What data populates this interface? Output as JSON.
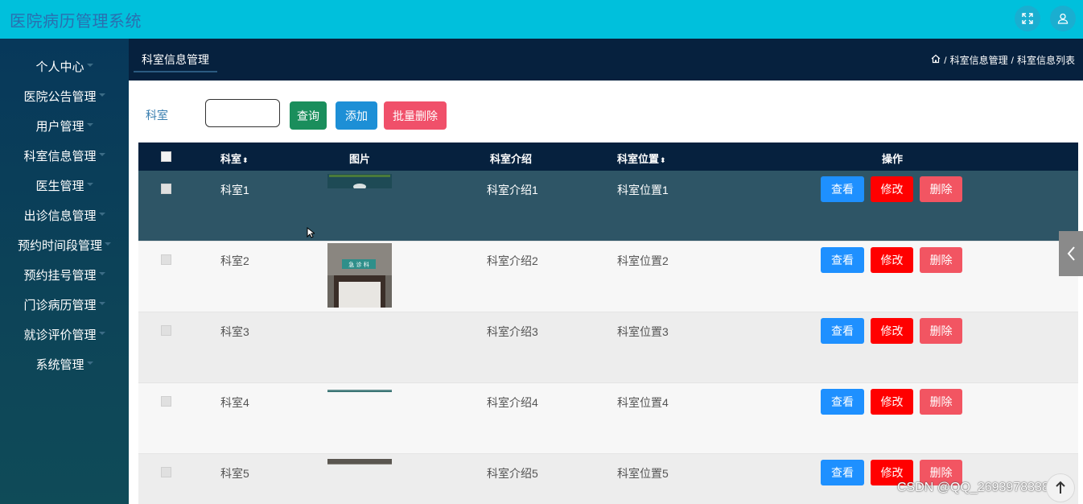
{
  "app": {
    "title": "医院病历管理系统"
  },
  "sidebar": {
    "items": [
      {
        "label": "个人中心"
      },
      {
        "label": "医院公告管理"
      },
      {
        "label": "用户管理"
      },
      {
        "label": "科室信息管理"
      },
      {
        "label": "医生管理"
      },
      {
        "label": "出诊信息管理"
      },
      {
        "label": "预约时间段管理"
      },
      {
        "label": "预约挂号管理"
      },
      {
        "label": "门诊病历管理"
      },
      {
        "label": "就诊评价管理"
      },
      {
        "label": "系统管理"
      }
    ]
  },
  "subheader": {
    "tab": "科室信息管理",
    "breadcrumb": [
      "科室信息管理",
      "科室信息列表"
    ],
    "separator": "/"
  },
  "search": {
    "label": "科室",
    "value": ""
  },
  "buttons": {
    "query": "查询",
    "add": "添加",
    "batch_delete": "批量删除"
  },
  "table": {
    "headers": {
      "name": "科室",
      "image": "图片",
      "intro": "科室介绍",
      "location": "科室位置",
      "actions": "操作"
    },
    "sort_icon": "⬍",
    "rows": [
      {
        "name": "科室1",
        "intro": "科室介绍1",
        "location": "科室位置1",
        "view": "查看",
        "edit": "修改",
        "delete": "删除"
      },
      {
        "name": "科室2",
        "intro": "科室介绍2",
        "location": "科室位置2",
        "view": "查看",
        "edit": "修改",
        "delete": "删除",
        "image_sign": "急 诊 科"
      },
      {
        "name": "科室3",
        "intro": "科室介绍3",
        "location": "科室位置3",
        "view": "查看",
        "edit": "修改",
        "delete": "删除"
      },
      {
        "name": "科室4",
        "intro": "科室介绍4",
        "location": "科室位置4",
        "view": "查看",
        "edit": "修改",
        "delete": "删除"
      },
      {
        "name": "科室5",
        "intro": "科室介绍5",
        "location": "科室位置5",
        "view": "查看",
        "edit": "修改",
        "delete": "删除"
      }
    ]
  },
  "watermark": "CSDN @QQ_2693978338",
  "icons": {
    "fullscreen": "fullscreen-icon",
    "user": "user-icon",
    "home": "home-icon",
    "collapse": "chevron-left-icon",
    "back_to_top": "arrow-up-icon"
  },
  "colors": {
    "topbar": "#00c0dc",
    "sidebar": "#07385a",
    "header": "#06213e",
    "view": "#1e90ff",
    "edit": "#ff0000",
    "delete": "#f25562"
  }
}
